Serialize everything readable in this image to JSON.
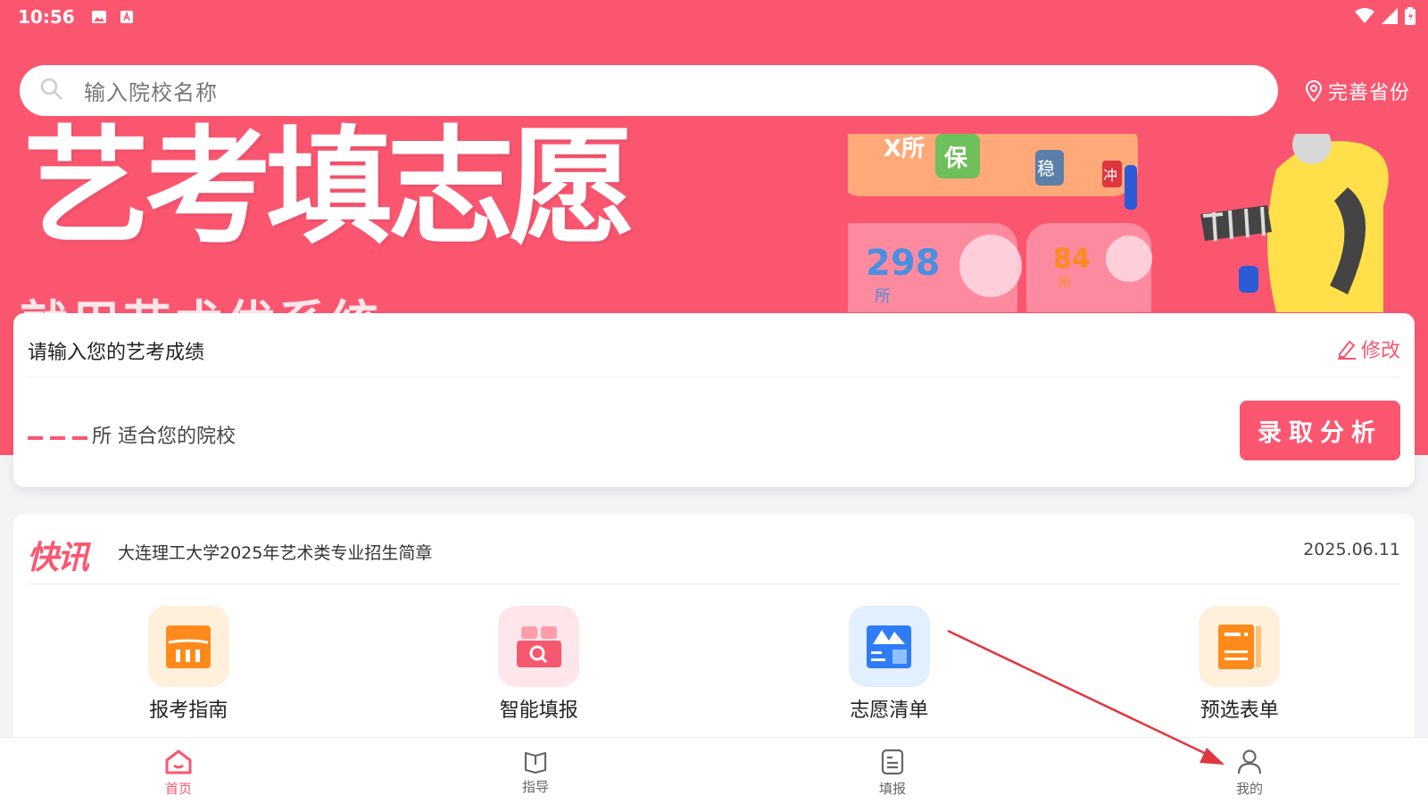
{
  "status_bar": {
    "time": "10:56"
  },
  "search": {
    "placeholder": "输入院校名称"
  },
  "province": {
    "label": "完善省份"
  },
  "banner": {
    "title": "艺考填志愿",
    "subtitle": "就用艺术优系统",
    "deco_298": "298",
    "deco_84": "84",
    "deco_unit": "所",
    "deco_x": "X所",
    "deco_bao": "保",
    "deco_wen": "稳",
    "deco_chong": "冲"
  },
  "score_card": {
    "prompt": "请输入您的艺考成绩",
    "edit_label": "修改",
    "result_text": "所 适合您的院校",
    "analyze_button": "录取分析"
  },
  "news": {
    "badge": "快讯",
    "title": "大连理工大学2025年艺术类专业招生简章",
    "date": "2025.06.11"
  },
  "tiles": [
    {
      "label": "报考指南",
      "icon": "chart-guide-icon",
      "bg": "#fff0dc",
      "color": "#ff8a1c"
    },
    {
      "label": "智能填报",
      "icon": "smart-fill-icon",
      "bg": "#ffe6ea",
      "color": "#f5586f"
    },
    {
      "label": "志愿清单",
      "icon": "wish-list-icon",
      "bg": "#e2efff",
      "color": "#2f7cf6"
    },
    {
      "label": "预选表单",
      "icon": "preselect-form-icon",
      "bg": "#fff0dc",
      "color": "#ff8a1c"
    }
  ],
  "tabbar": [
    {
      "label": "首页",
      "icon": "home-icon",
      "active": true
    },
    {
      "label": "指导",
      "icon": "book-icon",
      "active": false
    },
    {
      "label": "填报",
      "icon": "document-icon",
      "active": false
    },
    {
      "label": "我的",
      "icon": "person-icon",
      "active": false
    }
  ],
  "colors": {
    "brand": "#fb5670",
    "arrow": "#e0373f"
  }
}
